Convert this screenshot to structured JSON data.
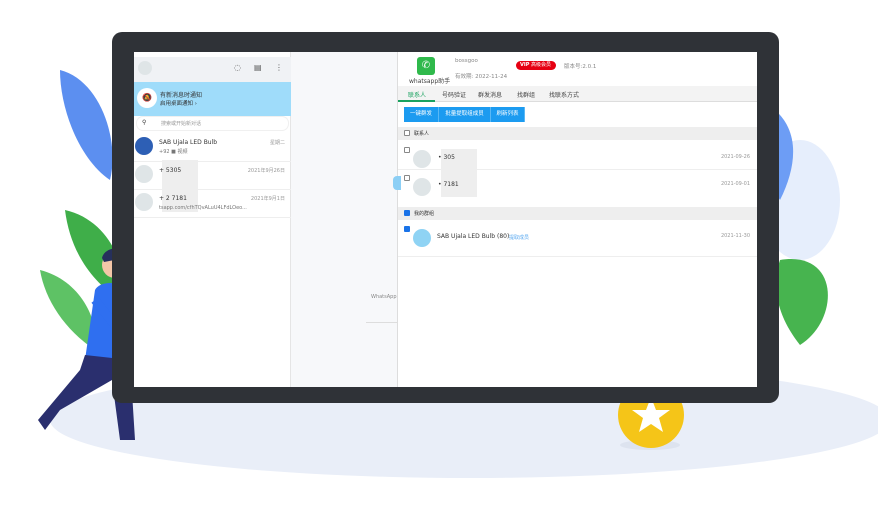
{
  "whatsapp": {
    "notify_title": "有新消息时通知",
    "notify_sub": "启用桌面通知 ›",
    "search_placeholder": "搜索或开始新对话",
    "chats": [
      {
        "name": "SAB Ujala LED Bulb",
        "preview": "+92 ■ 视频",
        "time": "星期二"
      },
      {
        "name": "+ 5305",
        "preview": "",
        "time": "2021年9月26日"
      },
      {
        "name": "+ 2 7181",
        "preview": "tsapp.com/cfhTQvALuU4LFdLOeo...",
        "time": "2021年9月1日"
      }
    ],
    "middle_text": "WhatsApp"
  },
  "helper": {
    "app_name": "whatsapp助手",
    "user": "bossgoo",
    "expiry": "有效期: 2022-11-24",
    "vip_label": "VIP",
    "vip_text": "高级会员",
    "version": "版本号:2.0.1",
    "tabs": [
      "联系人",
      "号码验证",
      "群发消息",
      "找群组",
      "找联系方式"
    ],
    "active_tab": 0,
    "buttons": [
      "一键群发",
      "批量提取组成员",
      "刷新列表"
    ],
    "contacts_section": "联系人",
    "contacts": [
      {
        "name": "• 305",
        "date": "2021-09-26",
        "checked": false
      },
      {
        "name": "• 7181",
        "date": "2021-09-01",
        "checked": false
      }
    ],
    "groups_section": "我的群组",
    "groups": [
      {
        "name": "SAB Ujala LED Bulb (80)",
        "link": "提取成员",
        "date": "2021-11-30",
        "checked": true
      }
    ]
  },
  "colors": {
    "accent": "#1c9bf0",
    "whatsapp_green": "#00a884",
    "vip": "#e60012",
    "frame": "#2f3237",
    "coin": "#f5c518"
  }
}
